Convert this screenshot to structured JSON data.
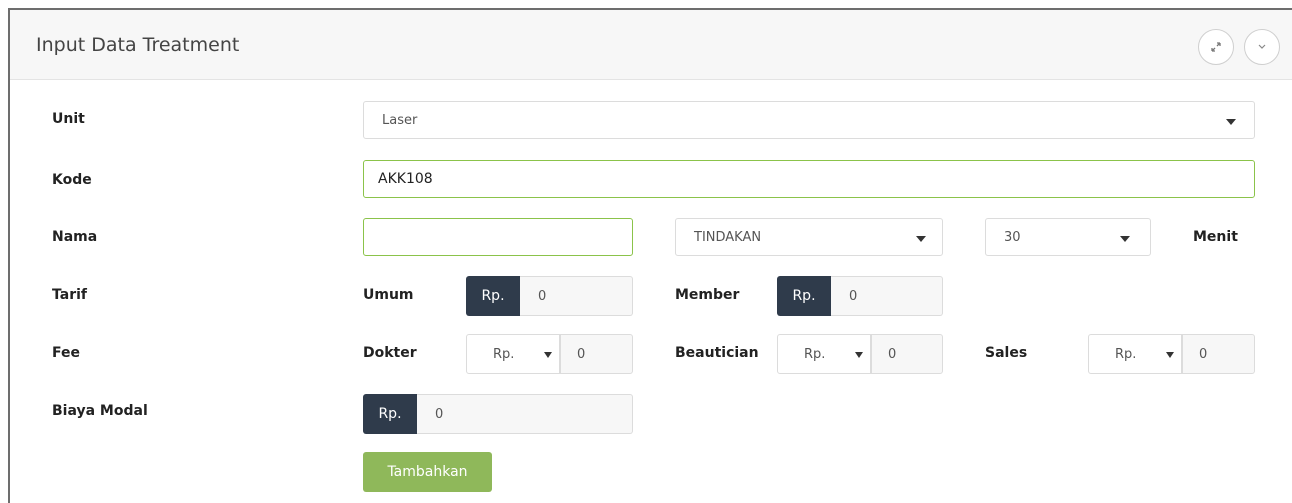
{
  "panel": {
    "title": "Input Data Treatment",
    "expand_icon": "expand-icon",
    "collapse_icon": "chevron-down-icon"
  },
  "form": {
    "unit": {
      "label": "Unit",
      "value": "Laser"
    },
    "kode": {
      "label": "Kode",
      "value": "AKK108"
    },
    "nama": {
      "label": "Nama",
      "value": "",
      "type_select": "TINDAKAN",
      "duration_select": "30",
      "duration_unit": "Menit"
    },
    "tarif": {
      "label": "Tarif",
      "umum": {
        "label": "Umum",
        "prefix": "Rp.",
        "value": "0"
      },
      "member": {
        "label": "Member",
        "prefix": "Rp.",
        "value": "0"
      }
    },
    "fee": {
      "label": "Fee",
      "dokter": {
        "label": "Dokter",
        "prefix": "Rp.",
        "value": "0"
      },
      "beautician": {
        "label": "Beautician",
        "prefix": "Rp.",
        "value": "0"
      },
      "sales": {
        "label": "Sales",
        "prefix": "Rp.",
        "value": "0"
      }
    },
    "biaya_modal": {
      "label": "Biaya Modal",
      "prefix": "Rp.",
      "value": "0"
    },
    "submit_label": "Tambahkan"
  },
  "colors": {
    "accent_green": "#8fb85a",
    "dark_prefix": "#2f3b4b",
    "field_border_focus": "#8bc34a"
  }
}
